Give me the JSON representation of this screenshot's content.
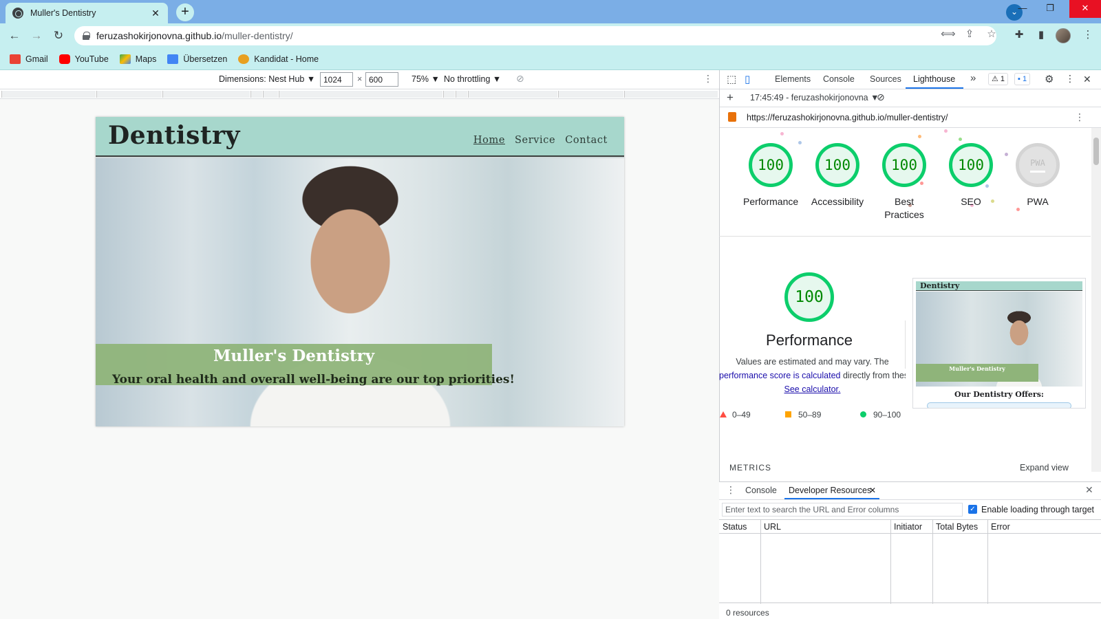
{
  "browser": {
    "tab_title": "Muller's Dentistry",
    "tab_close": "✕",
    "new_tab": "+",
    "url_host": "feruzashokirjonovna.github.io",
    "url_path": "/muller-dentistry/",
    "accent": "#7baee6",
    "toolbar_color": "#c6eff0"
  },
  "bookmarks": [
    {
      "label": "Gmail",
      "color": "#ea4335"
    },
    {
      "label": "YouTube",
      "color": "#ff0000"
    },
    {
      "label": "Maps",
      "color": "#34a853"
    },
    {
      "label": "Übersetzen",
      "color": "#4285f4"
    },
    {
      "label": "Kandidat - Home",
      "color": "#e8a020"
    }
  ],
  "device_toolbar": {
    "dimensions_label": "Dimensions: Nest Hub ▼",
    "width": "1024",
    "times": "×",
    "height": "600",
    "zoom": "75% ▼",
    "throttling": "No throttling ▼"
  },
  "site": {
    "logo": "Dentistry",
    "nav": [
      "Home",
      "Service",
      "Contact"
    ],
    "hero_title": "Muller's Dentistry",
    "hero_subtitle": "Your oral health and overall well-being are our top priorities!",
    "header_color": "#a7d7cc",
    "band_color": "#8fb47a"
  },
  "devtools": {
    "tabs": [
      "Elements",
      "Console",
      "Sources",
      "Lighthouse"
    ],
    "more": "»",
    "warnings": "⚠ 1",
    "messages": "1",
    "report_time": "17:45:49 - feruzashokirjonovna ▼",
    "report_url": "https://feruzashokirjonovna.github.io/muller-dentistry/",
    "categories": [
      {
        "label": "Performance",
        "score": "100"
      },
      {
        "label": "Accessibility",
        "score": "100"
      },
      {
        "label": "Best Practices",
        "score": "100"
      },
      {
        "label": "SEO",
        "score": "100"
      },
      {
        "label": "PWA",
        "score": "PWA"
      }
    ],
    "perf_score": "100",
    "perf_title": "Performance",
    "desc_1": "Values are estimated and may vary. The",
    "desc_link_1": "performance score is calculated",
    "desc_2": "directly from these metrics.",
    "desc_link_2": "See calculator.",
    "legend": [
      {
        "range": "0–49",
        "color": "#ff4e42"
      },
      {
        "range": "50–89",
        "color": "#ffa400"
      },
      {
        "range": "90–100",
        "color": "#0cce6b"
      }
    ],
    "thumb_logo": "Dentistry",
    "thumb_title": "Muller's Dentistry",
    "thumb_offers": "Our Dentistry Offers:",
    "metrics": "METRICS",
    "expand": "Expand view",
    "good_color": "#0cce6b"
  },
  "drawer": {
    "tabs": [
      "Console",
      "Developer Resources"
    ],
    "search_placeholder": "Enter text to search the URL and Error columns",
    "checkbox_label": "Enable loading through target",
    "columns": [
      "Status",
      "URL",
      "Initiator",
      "Total Bytes",
      "Error"
    ],
    "footer": "0 resources"
  }
}
